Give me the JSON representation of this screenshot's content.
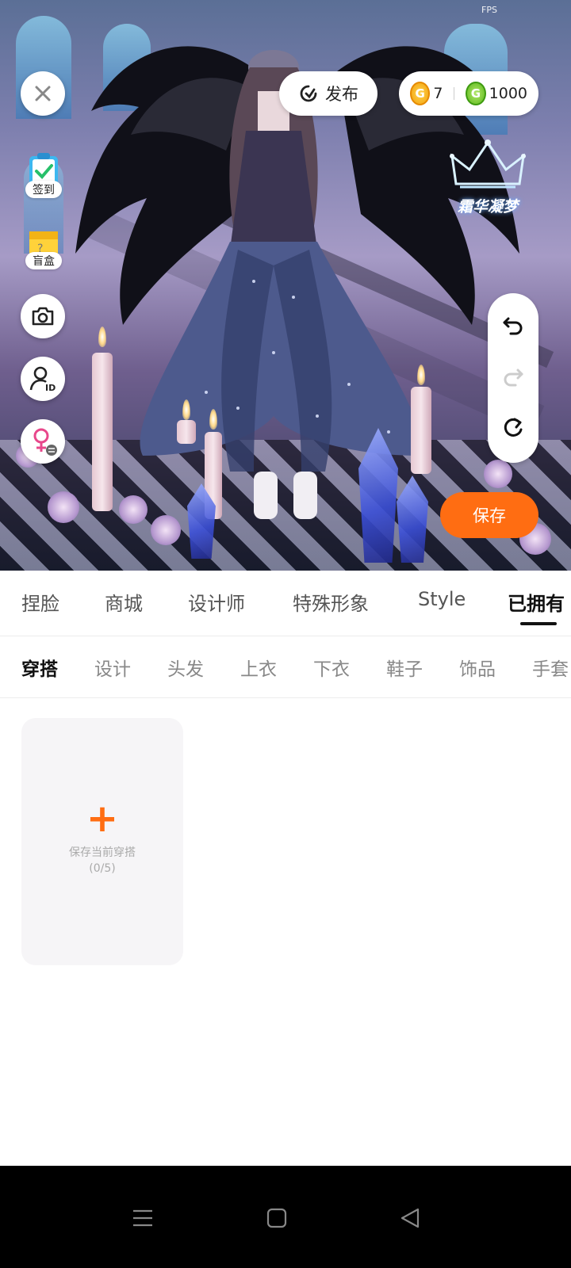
{
  "status": {
    "fps_label": "FPS"
  },
  "top_bar": {
    "publish_label": "发布",
    "currency": {
      "gold_value": "7",
      "green_value": "1000"
    }
  },
  "side_menu": {
    "checkin_label": "签到",
    "blindbox_label": "盲盒"
  },
  "brand": {
    "logo_text": "霜华凝梦"
  },
  "save_button_label": "保存",
  "main_tabs": [
    "捏脸",
    "商城",
    "设计师",
    "特殊形象",
    "Style",
    "已拥有"
  ],
  "main_tabs_active": "已拥有",
  "sub_tabs": [
    "穿搭",
    "设计",
    "头发",
    "上衣",
    "下衣",
    "鞋子",
    "饰品",
    "手套"
  ],
  "sub_tabs_active": "穿搭",
  "outfit_card": {
    "label": "保存当前穿搭",
    "count": "(0/5)"
  },
  "colors": {
    "accent": "#ff6d12",
    "gold_coin": "#f2a30f",
    "green_coin": "#59b81a",
    "card_bg": "#f6f5f7"
  },
  "icons": {
    "close": "close-icon",
    "checkin": "clipboard-check-icon",
    "blindbox": "mystery-box-icon",
    "camera": "camera-icon",
    "profile": "user-id-icon",
    "gender": "female-switch-icon",
    "publish": "publish-refresh-icon",
    "undo": "undo-icon",
    "redo": "redo-icon",
    "reset": "reset-icon",
    "nav_menu": "menu-icon",
    "nav_home": "home-square-icon",
    "nav_back": "back-triangle-icon"
  }
}
